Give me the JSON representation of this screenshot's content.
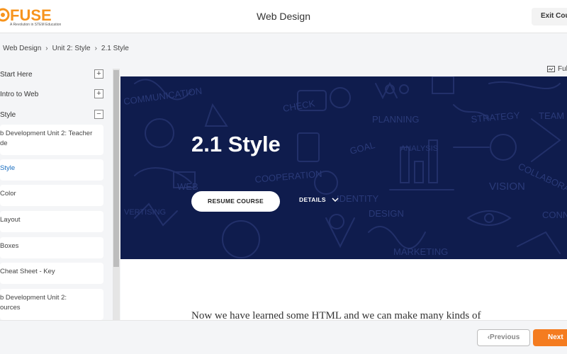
{
  "header": {
    "logo_text": "FUSE",
    "logo_tagline": "A Revolution in STEM Education",
    "title": "Web Design",
    "exit_label": "Exit Cou"
  },
  "breadcrumb": [
    "Web Design",
    "Unit 2: Style",
    "2.1 Style"
  ],
  "sidebar": {
    "units": [
      {
        "label": "Start Here",
        "toggle": "+"
      },
      {
        "label": "Intro to Web",
        "toggle": "+"
      },
      {
        "label": "Style",
        "toggle": "−"
      }
    ],
    "lessons": [
      {
        "label": "b Development Unit 2: Teacher de",
        "line1": "b Development Unit 2: Teacher",
        "line2": "de"
      },
      {
        "label": "Style"
      },
      {
        "label": "Color"
      },
      {
        "label": "Layout"
      },
      {
        "label": "Boxes"
      },
      {
        "label": "Cheat Sheet - Key"
      },
      {
        "label": "b Development Unit 2: ources",
        "line1": "b Development Unit 2:",
        "line2": "ources"
      }
    ]
  },
  "fullscreen_label": "Ful",
  "hero": {
    "title": "2.1 Style",
    "resume_label": "RESUME COURSE",
    "details_label": "DETAILS"
  },
  "body_text": "Now we have learned some HTML and we can make many kinds of",
  "footer": {
    "prev_label": "Previous",
    "next_label": "Next"
  },
  "colors": {
    "accent": "#f47c20",
    "hero_bg": "#0f1c4d",
    "active_link": "#1a6ec0"
  }
}
